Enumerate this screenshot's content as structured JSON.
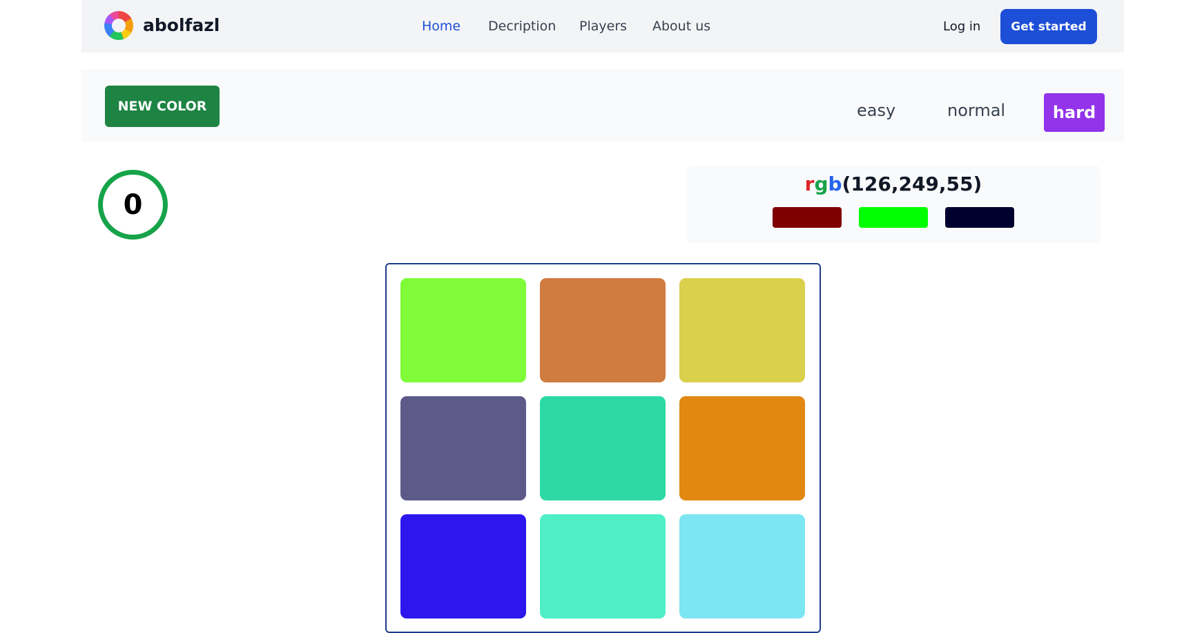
{
  "header": {
    "brand": "abolfazl",
    "nav": [
      "Home",
      "Decription",
      "Players",
      "About us"
    ],
    "active_nav": "Home",
    "login": "Log in",
    "get_started": "Get started"
  },
  "toolbar": {
    "new_color": "NEW COLOR",
    "levels": [
      "easy",
      "normal",
      "hard"
    ],
    "active_level": "hard"
  },
  "score": "0",
  "target": {
    "prefix_r": "r",
    "prefix_g": "g",
    "prefix_b": "b",
    "value": "(126,249,55)",
    "chips": [
      "#800000",
      "#00ff00",
      "#00002e"
    ]
  },
  "tiles": [
    "#7ffb3a",
    "#d07b3f",
    "#dbd04b",
    "#5d5a89",
    "#2dd9a3",
    "#e18712",
    "#2c17ee",
    "#4eefc7",
    "#7de6f2"
  ],
  "colors": {
    "accent": "#1d4ed8",
    "new_color_button": "#1d8443",
    "hard_level": "#9333ea",
    "score_ring": "#16a34a"
  }
}
